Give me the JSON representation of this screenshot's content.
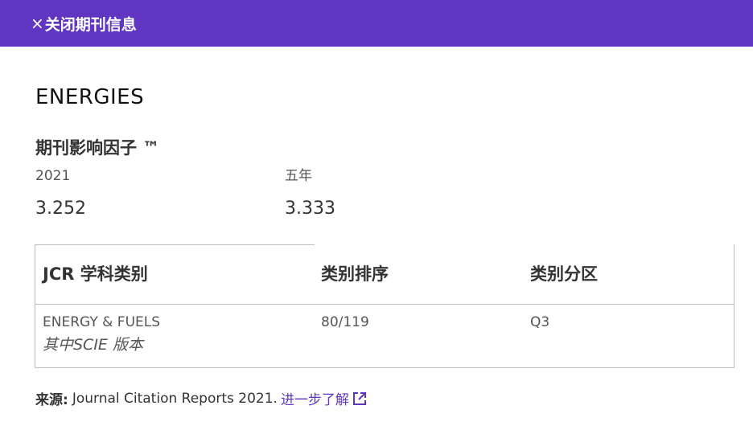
{
  "header": {
    "close_icon": "×",
    "close_label": "关闭期刊信息"
  },
  "journal": {
    "title": "ENERGIES"
  },
  "impact_factor": {
    "heading": "期刊影响因子 ™",
    "year_label": "2021",
    "year_value": "3.252",
    "five_year_label": "五年",
    "five_year_value": "3.333"
  },
  "jcr_table": {
    "headers": {
      "category": "JCR 学科类别",
      "rank": "类别排序",
      "quartile": "类别分区"
    },
    "rows": [
      {
        "category": "ENERGY & FUELS",
        "edition": "其中SCIE 版本",
        "rank": "80/119",
        "quartile": "Q3"
      }
    ]
  },
  "source": {
    "label": "来源:",
    "text": "Journal Citation Reports  2021.",
    "link_text": "进一步了解",
    "link_icon": "external-link-icon"
  },
  "colors": {
    "header_bg": "#5f35c2",
    "link": "#5f35c2",
    "border": "#bdbdbd"
  }
}
